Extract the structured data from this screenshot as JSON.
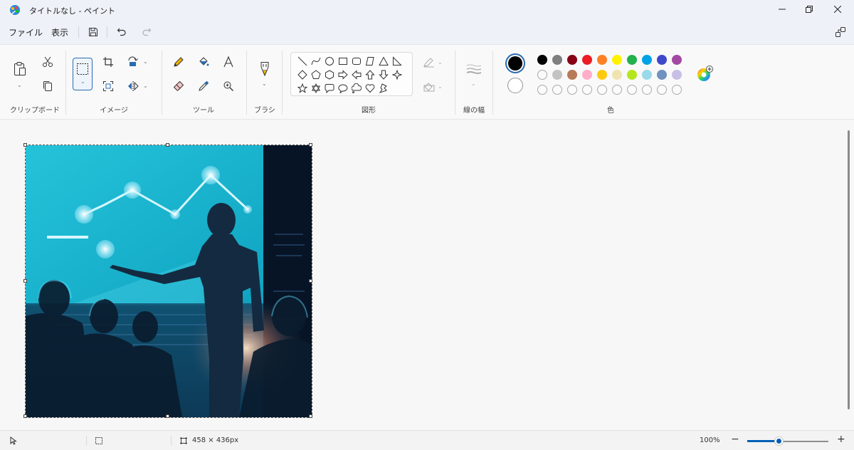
{
  "window": {
    "title": "タイトルなし - ペイント",
    "minimize_icon": "minimize-icon",
    "restore_icon": "restore-icon",
    "close_icon": "close-icon"
  },
  "menu": {
    "file": "ファイル",
    "view": "表示",
    "icons": [
      "save-icon",
      "undo-icon",
      "redo-icon",
      "share-icon"
    ]
  },
  "ribbon": {
    "clipboard": {
      "label": "クリップボード",
      "icons": [
        "paste-icon",
        "cut-icon",
        "copy-icon"
      ]
    },
    "image": {
      "label": "イメージ",
      "icons": [
        "select-icon",
        "crop-icon",
        "resize-icon",
        "rotate-icon",
        "flip-icon"
      ]
    },
    "tools": {
      "label": "ツール",
      "icons": [
        "pencil-icon",
        "fill-icon",
        "text-icon",
        "eraser-icon",
        "color-picker-icon",
        "magnifier-icon"
      ]
    },
    "brushes": {
      "label": "ブラシ",
      "icon": "brush-icon"
    },
    "shapes": {
      "label": "図形",
      "items": [
        "line",
        "curve",
        "oval",
        "rectangle",
        "rounded-rectangle",
        "polygon",
        "triangle",
        "right-triangle",
        "diamond",
        "pentagon",
        "hexagon",
        "right-arrow",
        "left-arrow",
        "up-arrow",
        "down-arrow",
        "four-point-star",
        "five-point-star",
        "six-point-star",
        "rounded-callout",
        "oval-callout",
        "cloud-callout",
        "heart",
        "lightning"
      ],
      "outline_icon": "outline-icon",
      "fill_icon": "shape-fill-icon"
    },
    "size": {
      "label": "線の幅",
      "icon": "line-width-icon"
    },
    "colors": {
      "label": "色",
      "primary": "#000000",
      "secondary": "#ffffff",
      "row1": [
        "#000000",
        "#7f7f7f",
        "#880015",
        "#ed1c24",
        "#ff7f27",
        "#fff200",
        "#22b14c",
        "#00a2e8",
        "#3f48cc",
        "#a349a4"
      ],
      "row2": [
        "",
        "#c3c3c3",
        "#b97a57",
        "#ffaec9",
        "#ffc90e",
        "#efe4b0",
        "#b5e61d",
        "#99d9ea",
        "#7092be",
        "#c8bfe7"
      ],
      "row3_count": 10,
      "edit_icon": "edit-colors-icon"
    }
  },
  "canvas": {
    "image": "presentation-speaker-image"
  },
  "status": {
    "pointer_icon": "cursor-position-icon",
    "selection_icon": "selection-size-icon",
    "canvas_icon": "canvas-size-icon",
    "canvas_size": "458 × 436px",
    "zoom": "100%",
    "zoom_value_percent": 100,
    "zoom_out": "−",
    "zoom_in": "+"
  }
}
